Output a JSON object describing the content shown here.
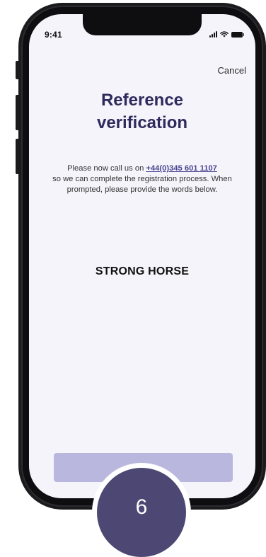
{
  "status_bar": {
    "time": "9:41"
  },
  "header": {
    "cancel_label": "Cancel"
  },
  "main": {
    "title_line1": "Reference",
    "title_line2": "verification",
    "instructions_prefix": "Please now call us on ",
    "phone_number": "+44(0)345 601 1107",
    "instructions_suffix": "so we can complete the registration process. When prompted, please provide the words below.",
    "verification_words": "STRONG HORSE"
  },
  "step": {
    "number": "6"
  },
  "colors": {
    "title": "#2e2a5c",
    "link": "#4b4590",
    "button": "#b9b7de",
    "badge": "#4d4873",
    "screen_background": "#f5f4fb"
  },
  "icons": [
    "signal-icon",
    "wifi-icon",
    "battery-icon"
  ]
}
